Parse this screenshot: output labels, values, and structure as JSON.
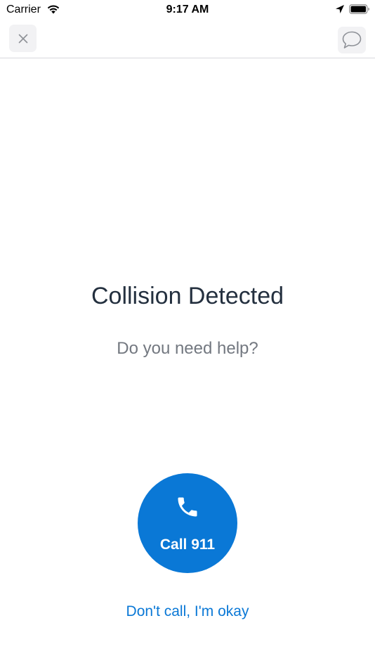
{
  "status_bar": {
    "carrier": "Carrier",
    "time": "9:17 AM",
    "icons": [
      "wifi-icon",
      "location-arrow-icon",
      "battery-icon"
    ]
  },
  "nav": {
    "close_icon": "close-icon",
    "chat_icon": "chat-bubble-icon"
  },
  "main": {
    "title": "Collision Detected",
    "subtitle": "Do you need help?",
    "call_button_label": "Call 911",
    "call_icon": "phone-icon",
    "dismiss_label": "Don't call, I'm okay"
  },
  "colors": {
    "accent": "#0a78d6",
    "title": "#24303f",
    "subtitle": "#737880",
    "button_bg": "#f2f2f4"
  }
}
